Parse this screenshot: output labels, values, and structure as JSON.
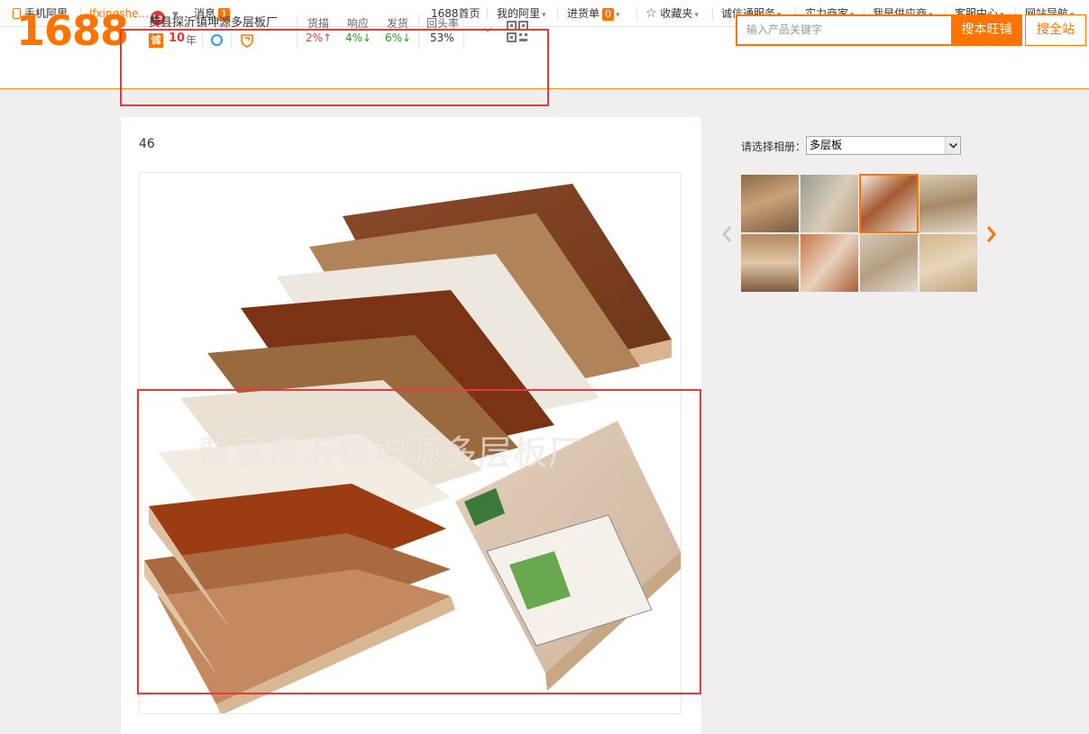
{
  "topnav": {
    "mobile_ali": "手机阿里",
    "username": "lfxingshe...",
    "level_badge": "Lo",
    "messages_label": "消息",
    "messages_count": "1",
    "home": "1688首页",
    "my_ali": "我的阿里",
    "purchase_list": "进货单",
    "purchase_count": "0",
    "favorites": "收藏夹",
    "trust_service": "诚信通服务",
    "strong_merchant": "实力商家",
    "i_am_supplier": "我是供应商",
    "customer_service": "客服中心",
    "site_nav": "网站导航"
  },
  "header": {
    "logo": "1688",
    "company_name": "费县探沂镇坤源多层板厂",
    "cheng_badge": "诚",
    "years": "10",
    "years_unit": "年",
    "stats": [
      {
        "label": "货描",
        "value": "2%↑",
        "trend": "up"
      },
      {
        "label": "响应",
        "value": "4%↓",
        "trend": "down"
      },
      {
        "label": "发货",
        "value": "6%↓",
        "trend": "down"
      },
      {
        "label": "回头率",
        "value": "53%",
        "trend": "neutral"
      }
    ],
    "search_placeholder": "输入产品关键字",
    "search_shop_button": "搜本旺铺",
    "search_all_button": "搜全站"
  },
  "main": {
    "photo_number": "46",
    "watermark": "费县探沂镇坤源多层板厂"
  },
  "sidebar": {
    "album_label": "请选择相册：",
    "album_selected": "多层板",
    "selected_thumb_index": 2
  },
  "colors": {
    "brand": "#ff7300",
    "highlight_box": "#e8393d",
    "up": "#e4393c",
    "down": "#26a11b"
  }
}
